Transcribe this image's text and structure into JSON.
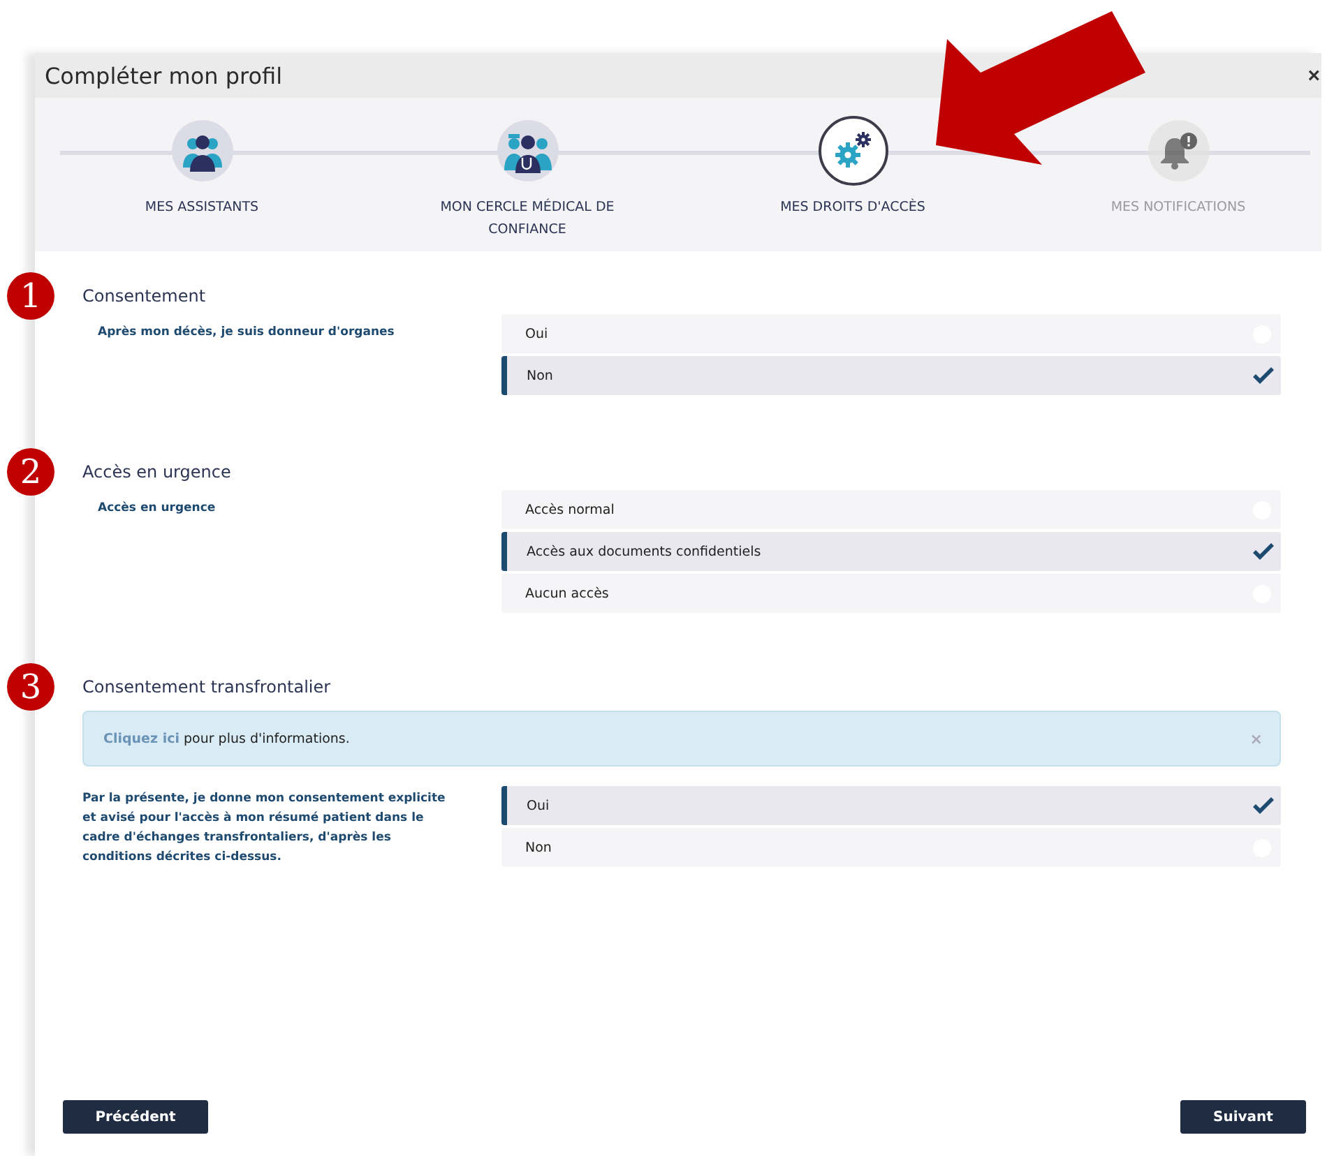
{
  "window": {
    "title": "Compléter mon profil",
    "close": "×"
  },
  "steps": [
    {
      "label": "MES ASSISTANTS",
      "selected": false,
      "disabled": false
    },
    {
      "label": "MON CERCLE MÉDICAL DE CONFIANCE",
      "selected": false,
      "disabled": false
    },
    {
      "label": "MES DROITS D'ACCÈS",
      "selected": true,
      "disabled": false
    },
    {
      "label": "MES NOTIFICATIONS",
      "selected": false,
      "disabled": true
    }
  ],
  "sections": [
    {
      "marker": "1",
      "title": "Consentement",
      "question": "Après mon décès, je suis donneur d'organes",
      "options": [
        {
          "label": "Oui",
          "selected": false
        },
        {
          "label": "Non",
          "selected": true
        }
      ]
    },
    {
      "marker": "2",
      "title": "Accès en urgence",
      "question": "Accès en urgence",
      "options": [
        {
          "label": "Accès normal",
          "selected": false
        },
        {
          "label": "Accès aux documents confidentiels",
          "selected": true
        },
        {
          "label": "Aucun accès",
          "selected": false
        }
      ]
    },
    {
      "marker": "3",
      "title": "Consentement transfrontalier",
      "alert": {
        "link": "Cliquez ici",
        "text": "pour plus d'informations.",
        "close": "×"
      },
      "question": "Par la présente, je donne mon consentement explicite et avisé pour l'accès à mon résumé patient dans le cadre d'échanges transfrontaliers, d'après les conditions décrites ci-dessus.",
      "options": [
        {
          "label": "Oui",
          "selected": true
        },
        {
          "label": "Non",
          "selected": false
        }
      ]
    }
  ],
  "buttons": {
    "previous": "Précédent",
    "next": "Suivant"
  }
}
